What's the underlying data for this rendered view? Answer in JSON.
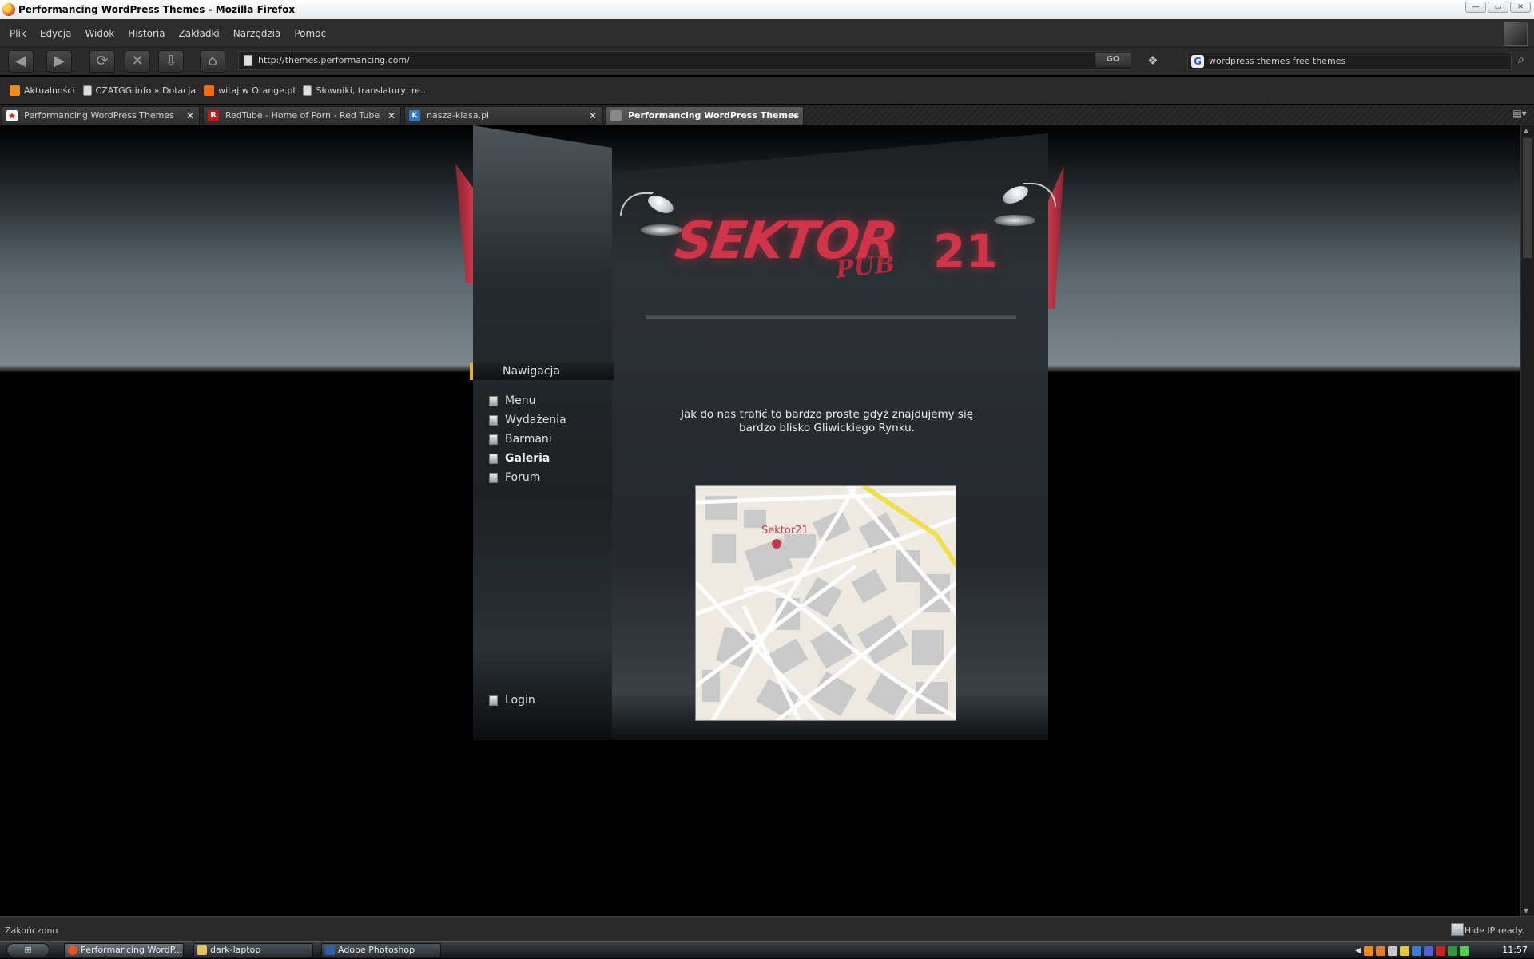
{
  "window": {
    "title": "Performancing WordPress Themes - Mozilla Firefox"
  },
  "menubar": {
    "items": [
      "Plik",
      "Edycja",
      "Widok",
      "Historia",
      "Zakładki",
      "Narzędzia",
      "Pomoc"
    ]
  },
  "toolbar": {
    "url": "http://themes.performancing.com/",
    "go_label": "GO",
    "search_value": "wordpress themes free themes"
  },
  "bookmarks": [
    "Aktualności",
    "CZATGG.info » Dotacja",
    "witaj w Orange.pl",
    "Słowniki, translatory, re..."
  ],
  "tabs": [
    {
      "label": "Performancing WordPress Themes",
      "active": false
    },
    {
      "label": "RedTube - Home of Porn - Red Tube",
      "active": false
    },
    {
      "label": "nasza-klasa.pl",
      "active": false
    },
    {
      "label": "Performancing WordPress Themes",
      "active": true
    }
  ],
  "site": {
    "logo_main": "SEKTOR",
    "logo_sub": "PUB",
    "logo_number": "21",
    "nav_title": "Nawigacja",
    "nav_items": [
      "Menu",
      "Wydażenia",
      "Barmani",
      "Galeria",
      "Forum"
    ],
    "login_label": "Login",
    "intro_text": "Jak do nas trafić to bardzo proste gdyż znajdujemy się bardzo blisko Gliwickiego Rynku.",
    "map_marker_label": "Sektor21"
  },
  "status": {
    "left": "Zakończono",
    "right": "Hide IP ready."
  },
  "taskbar": {
    "tasks": [
      "Performancing WordP...",
      "dark-laptop",
      "Adobe Photoshop"
    ],
    "clock": "11:57"
  },
  "colors": {
    "accent_red": "#d23447",
    "nav_marker": "#e8b32b"
  }
}
